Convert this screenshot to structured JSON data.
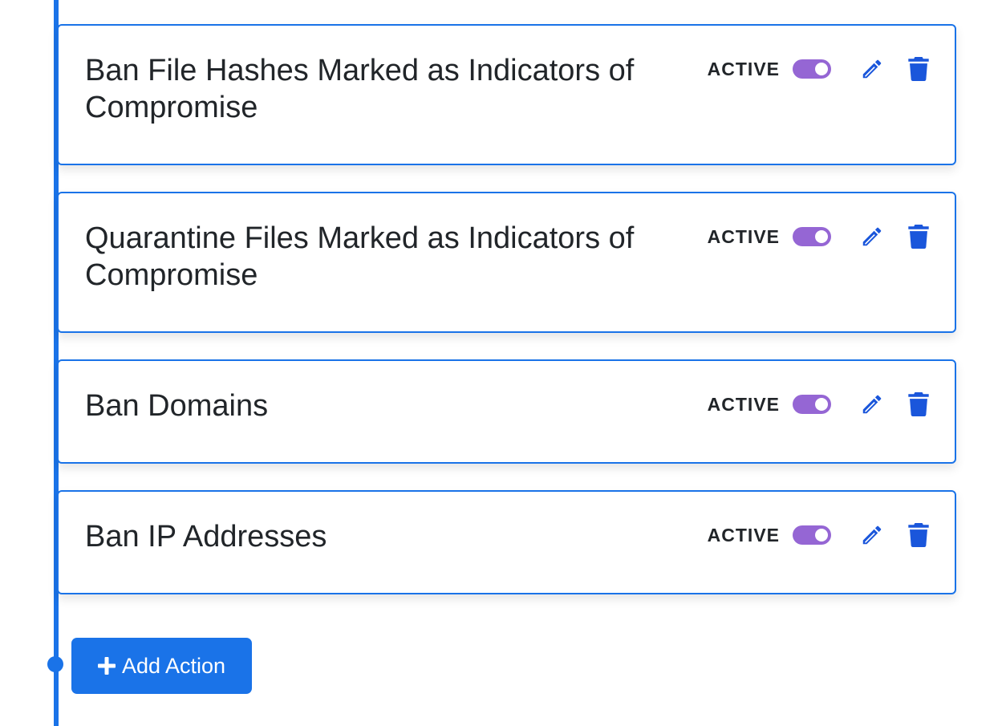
{
  "theme": {
    "accent": "#1a73e8",
    "toggle_on": "#9566d4",
    "text": "#212529"
  },
  "actions": [
    {
      "title": "Ban File Hashes Marked as Indicators of Compromise",
      "status": "ACTIVE",
      "enabled": true,
      "edit_icon": "pencil-icon",
      "delete_icon": "trash-icon"
    },
    {
      "title": "Quarantine Files Marked as Indicators of Compromise",
      "status": "ACTIVE",
      "enabled": true,
      "edit_icon": "pencil-icon",
      "delete_icon": "trash-icon"
    },
    {
      "title": "Ban Domains",
      "status": "ACTIVE",
      "enabled": true,
      "edit_icon": "pencil-icon",
      "delete_icon": "trash-icon"
    },
    {
      "title": "Ban IP Addresses",
      "status": "ACTIVE",
      "enabled": true,
      "edit_icon": "pencil-icon",
      "delete_icon": "trash-icon"
    }
  ],
  "add_button": {
    "label": "Add Action",
    "icon": "plus-icon"
  }
}
